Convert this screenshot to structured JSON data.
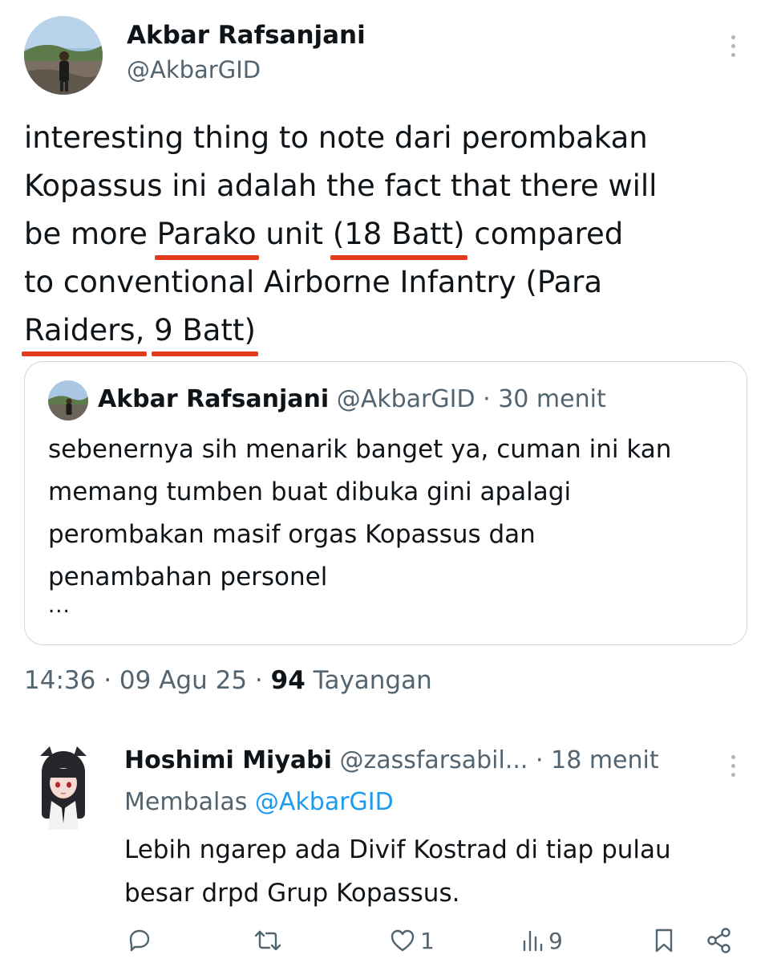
{
  "tweet": {
    "author_name": "Akbar Rafsanjani",
    "author_handle": "@AkbarGID",
    "text": {
      "l1": "interesting thing to note dari perombakan",
      "l2": "Kopassus ini adalah the fact that there will",
      "l3_a": "be more ",
      "l3_u1": "Parako",
      "l3_b": " unit ",
      "l3_u2": "(18 Batt)",
      "l3_c": " compared",
      "l4": "to conventional Airborne Infantry (Para",
      "l5_u1": "Raiders,",
      "l5_sp": " ",
      "l5_u2": "9 Batt)"
    },
    "time": "14:36",
    "sep": "·",
    "date": "09 Agu 25",
    "views_count": "94",
    "views_label": "Tayangan"
  },
  "quote": {
    "author_name": "Akbar Rafsanjani",
    "author_handle": "@AkbarGID",
    "sep": "·",
    "time_ago": "30 menit",
    "lines": [
      "sebenernya sih menarik banget ya, cuman ini kan",
      "memang tumben buat dibuka gini apalagi",
      "perombakan masif orgas Kopassus dan",
      "penambahan personel"
    ],
    "ellipsis": "..."
  },
  "reply": {
    "author_name": "Hoshimi Miyabi",
    "author_handle": "@zassfarsabil...",
    "sep": "·",
    "time_ago": "18 menit",
    "replying_label": "Membalas",
    "replying_to": "@AkbarGID",
    "lines": [
      "Lebih ngarep ada Divif Kostrad di tiap pulau",
      "besar drpd Grup Kopassus."
    ],
    "actions": {
      "likes": "1",
      "views": "9"
    }
  },
  "icons": {
    "reply": "reply-icon",
    "retweet": "retweet-icon",
    "like": "heart-icon",
    "views": "views-icon",
    "bookmark": "bookmark-icon",
    "share": "share-icon",
    "more": "more-icon"
  },
  "colors": {
    "text": "#0f1419",
    "secondary": "#536471",
    "link": "#1d9bf0",
    "underline_annotation": "#e23a1e",
    "border": "#cfd9de"
  }
}
